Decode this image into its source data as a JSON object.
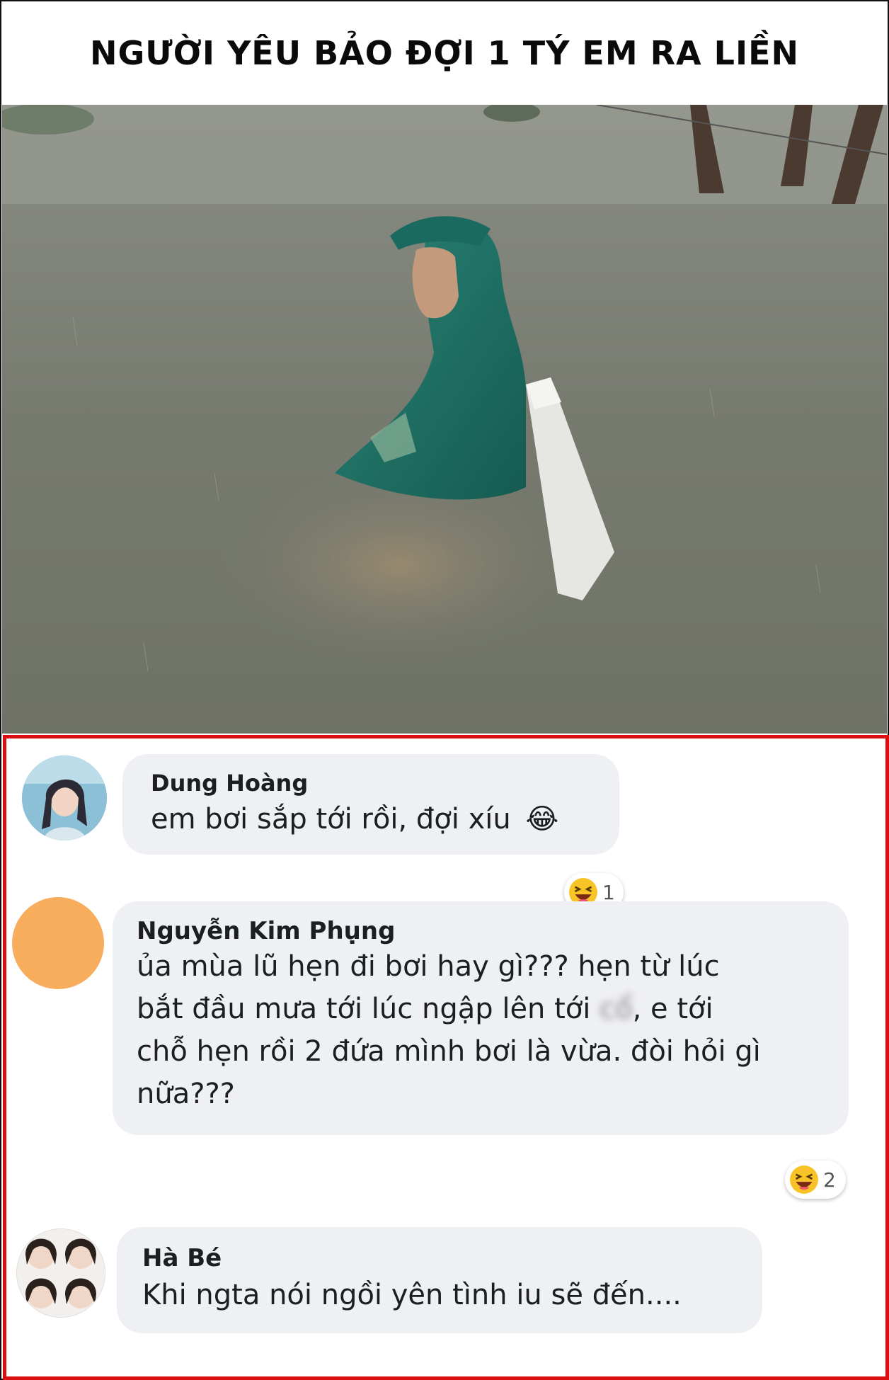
{
  "title": "NGƯỜI YÊU BẢO ĐỢI 1 TÝ EM RA LIỀN",
  "colors": {
    "comment_border": "#d90f12",
    "bubble_bg": "#eff0f3",
    "avatar_orange": "#f8ad5c",
    "raincoat": "#1f6e62",
    "floodwater": "#767a6e"
  },
  "comments": [
    {
      "name": "Dung Hoàng",
      "text": "em bơi sắp tới rồi, đợi xíu",
      "emoji": "😂",
      "reaction_icon": "laughing-face-icon",
      "reaction_count": "1"
    },
    {
      "name": "Nguyễn Kim Phụng",
      "lines": [
        "ủa mùa lũ hẹn đi bơi hay gì??? hẹn từ lúc",
        "bắt đầu mưa tới lúc ngập lên tới ",
        "chỗ hẹn rồi 2 đứa mình bơi là vừa. đòi hỏi gì",
        "nữa???"
      ],
      "blurred_word": "cổ",
      "line2_tail": ", e tới",
      "reaction_icon": "laughing-face-icon",
      "reaction_count": "2"
    },
    {
      "name": "Hà Bé",
      "text": "Khi ngta nói ngồi yên tình iu sẽ đến...."
    }
  ]
}
